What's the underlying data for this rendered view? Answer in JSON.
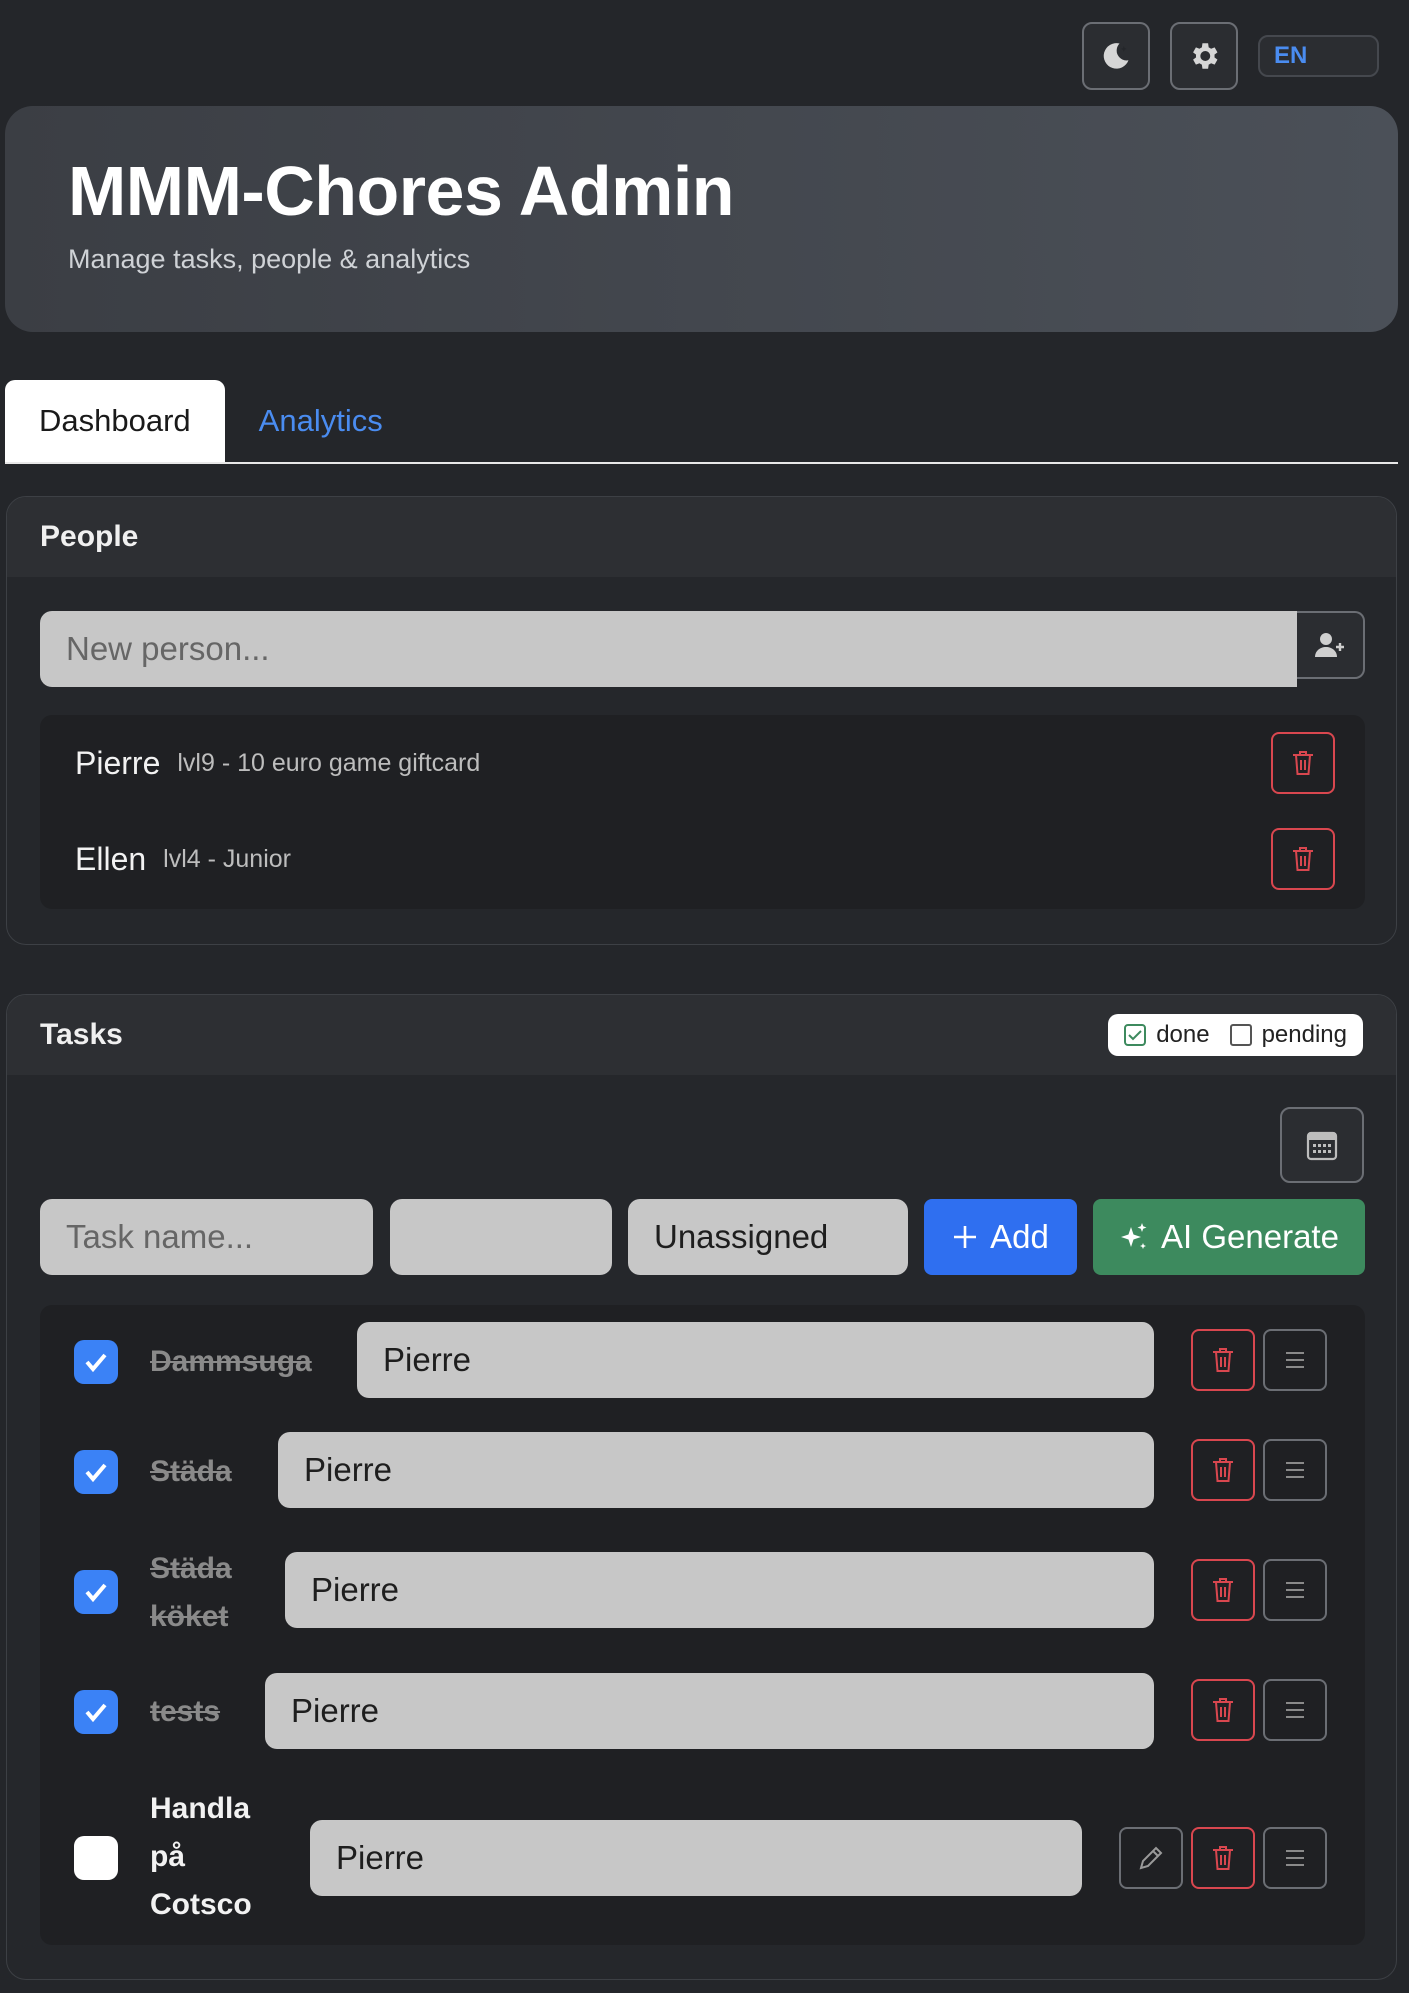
{
  "topbar": {
    "theme_icon": "moon-stars-icon",
    "settings_icon": "gear-icon",
    "language": "EN"
  },
  "hero": {
    "title": "MMM-Chores Admin",
    "subtitle": "Manage tasks, people & analytics"
  },
  "tabs": [
    {
      "label": "Dashboard",
      "active": true
    },
    {
      "label": "Analytics",
      "active": false
    }
  ],
  "people": {
    "title": "People",
    "input_placeholder": "New person...",
    "add_icon": "person-plus-icon",
    "items": [
      {
        "name": "Pierre",
        "level": "lvl9 - 10 euro game giftcard"
      },
      {
        "name": "Ellen",
        "level": "lvl4 - Junior"
      }
    ]
  },
  "tasks": {
    "title": "Tasks",
    "legend": {
      "done": "done",
      "pending": "pending"
    },
    "form": {
      "name_placeholder": "Task name...",
      "date_value": "",
      "assignee_value": "Unassigned",
      "add_label": "Add",
      "ai_label": "AI Generate"
    },
    "items": [
      {
        "name": "Dammsuga",
        "done": true,
        "assignee": "Pierre"
      },
      {
        "name": "Städa",
        "done": true,
        "assignee": "Pierre"
      },
      {
        "name": "Städa köket",
        "done": true,
        "assignee": "Pierre"
      },
      {
        "name": "tests",
        "done": true,
        "assignee": "Pierre"
      },
      {
        "name": "Handla på Cotsco",
        "done": false,
        "assignee": "Pierre"
      }
    ]
  },
  "colors": {
    "background": "#24262a",
    "accent_blue": "#2f6ff0",
    "ai_green": "#3d8a5e",
    "danger_red": "#d9474f",
    "check_blue": "#3b82f6"
  }
}
